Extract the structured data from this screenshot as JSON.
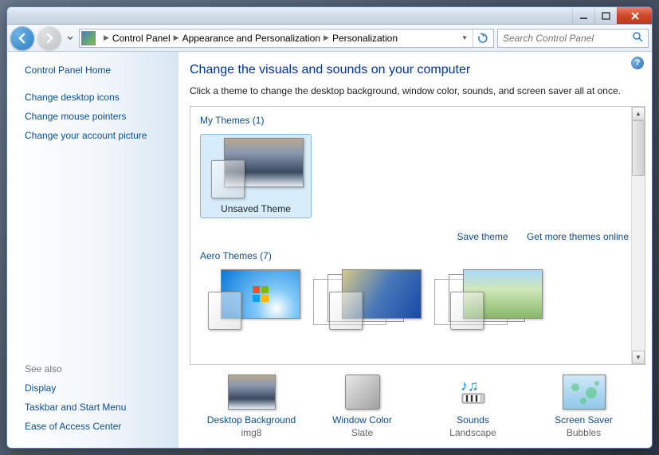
{
  "breadcrumb": {
    "seg1": "Control Panel",
    "seg2": "Appearance and Personalization",
    "seg3": "Personalization"
  },
  "search": {
    "placeholder": "Search Control Panel"
  },
  "sidebar": {
    "home": "Control Panel Home",
    "links": [
      "Change desktop icons",
      "Change mouse pointers",
      "Change your account picture"
    ],
    "see_also_label": "See also",
    "see_also": [
      "Display",
      "Taskbar and Start Menu",
      "Ease of Access Center"
    ]
  },
  "main": {
    "title": "Change the visuals and sounds on your computer",
    "subtitle": "Click a theme to change the desktop background, window color, sounds, and screen saver all at once.",
    "my_themes_header": "My Themes (1)",
    "unsaved_theme": "Unsaved Theme",
    "save_theme": "Save theme",
    "get_more": "Get more themes online",
    "aero_header": "Aero Themes (7)"
  },
  "bottom": {
    "desktop": {
      "label": "Desktop Background",
      "value": "img8"
    },
    "color": {
      "label": "Window Color",
      "value": "Slate"
    },
    "sounds": {
      "label": "Sounds",
      "value": "Landscape"
    },
    "saver": {
      "label": "Screen Saver",
      "value": "Bubbles"
    }
  }
}
